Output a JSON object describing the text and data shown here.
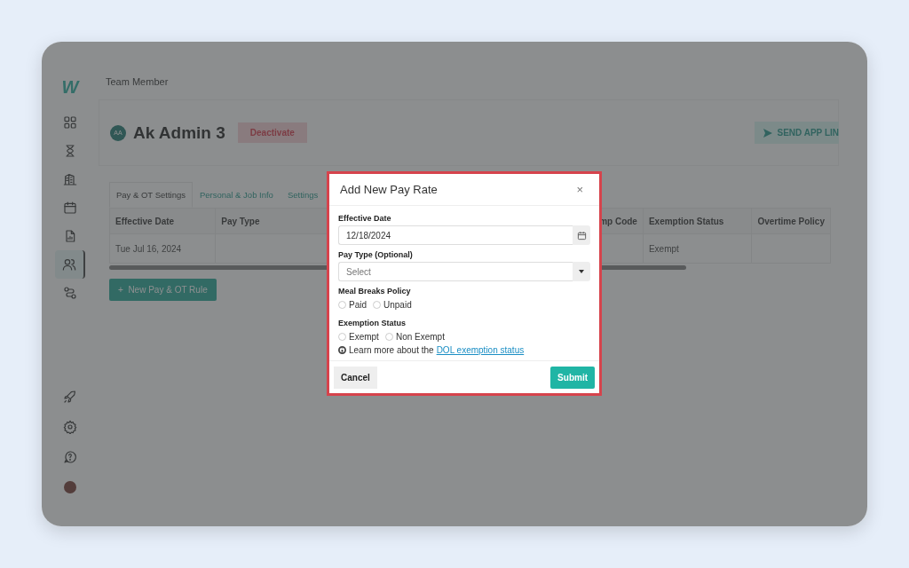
{
  "logo": "W",
  "sidebar": {
    "items": [
      {
        "kind": "grid",
        "selected": false
      },
      {
        "kind": "hourglass",
        "selected": false
      },
      {
        "kind": "building",
        "selected": false
      },
      {
        "kind": "calendar",
        "selected": false
      },
      {
        "kind": "document",
        "selected": false
      },
      {
        "kind": "people",
        "selected": true
      },
      {
        "kind": "route",
        "selected": false
      }
    ],
    "bottom_items": [
      {
        "kind": "rocket"
      },
      {
        "kind": "gear"
      },
      {
        "kind": "help"
      },
      {
        "kind": "avatar"
      }
    ]
  },
  "breadcrumb": "Team Member",
  "header": {
    "avatar_initials": "AA",
    "name": "Ak Admin 3",
    "deactivate_button": "Deactivate",
    "send_button": "SEND APP LIN"
  },
  "tabs": [
    {
      "label": "Pay & OT Settings",
      "selected": true
    },
    {
      "label": "Personal & Job Info",
      "selected": false
    },
    {
      "label": "Settings",
      "selected": false
    }
  ],
  "table": {
    "columns": [
      "Effective Date",
      "Pay Type",
      "mp Code",
      "Exemption Status",
      "Overtime Policy"
    ],
    "rows": [
      {
        "cells": [
          "Tue Jul 16, 2024",
          null,
          null,
          "Exempt",
          null
        ]
      }
    ]
  },
  "add_button": "+  New Pay & OT Rule",
  "modal": {
    "title": "Add New Pay Rate",
    "close": "×",
    "effective_date": {
      "label": "Effective Date",
      "value": "12/18/2024"
    },
    "pay_type": {
      "label": "Pay Type (Optional)",
      "placeholder": "Select"
    },
    "meal_breaks": {
      "label": "Meal Breaks Policy",
      "options": [
        {
          "label": "Paid",
          "selected": false
        },
        {
          "label": "Unpaid",
          "selected": false
        }
      ]
    },
    "exemption": {
      "label": "Exemption Status",
      "options": [
        {
          "label": "Exempt",
          "selected": false
        },
        {
          "label": "Non Exempt",
          "selected": false
        }
      ]
    },
    "info": {
      "text": "Learn more about the",
      "link": "DOL exemption status"
    },
    "cancel": "Cancel",
    "submit": "Submit"
  }
}
